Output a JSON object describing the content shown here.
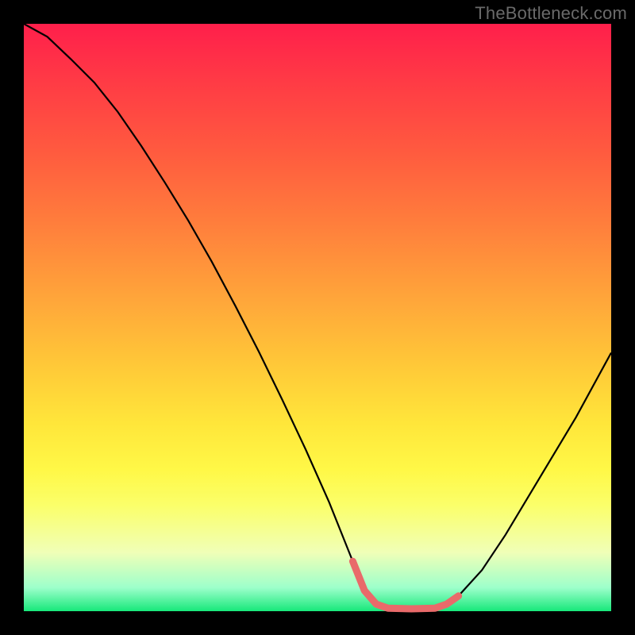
{
  "watermark": "TheBottleneck.com",
  "chart_data": {
    "type": "line",
    "title": "",
    "xlabel": "",
    "ylabel": "",
    "xlim": [
      0,
      100
    ],
    "ylim": [
      0,
      100
    ],
    "grid": false,
    "series": [
      {
        "name": "curve",
        "color": "#000000",
        "x": [
          0,
          4,
          8,
          12,
          16,
          20,
          24,
          28,
          32,
          36,
          40,
          44,
          48,
          52,
          56,
          58,
          60,
          62,
          66,
          70,
          72,
          74,
          78,
          82,
          88,
          94,
          100
        ],
        "values": [
          100,
          97.8,
          94,
          90,
          85,
          79.2,
          73,
          66.5,
          59.5,
          52,
          44.2,
          36,
          27.5,
          18.5,
          8.5,
          3.5,
          1.2,
          0.5,
          0.4,
          0.5,
          1.2,
          2.6,
          7,
          13,
          23,
          33,
          44
        ]
      },
      {
        "name": "accent",
        "color": "#e96a6a",
        "x": [
          56,
          58,
          60,
          62,
          66,
          70,
          72,
          74
        ],
        "values": [
          8.5,
          3.5,
          1.2,
          0.5,
          0.4,
          0.5,
          1.2,
          2.6
        ]
      }
    ],
    "background_gradient_stops": [
      {
        "pos": 0,
        "color": "#ff1f4b"
      },
      {
        "pos": 10,
        "color": "#ff3b45"
      },
      {
        "pos": 22,
        "color": "#ff5b3f"
      },
      {
        "pos": 34,
        "color": "#ff7e3c"
      },
      {
        "pos": 46,
        "color": "#ffa33a"
      },
      {
        "pos": 58,
        "color": "#ffc838"
      },
      {
        "pos": 68,
        "color": "#ffe63a"
      },
      {
        "pos": 76,
        "color": "#fff847"
      },
      {
        "pos": 82,
        "color": "#fbff6a"
      },
      {
        "pos": 90,
        "color": "#f0ffb7"
      },
      {
        "pos": 96,
        "color": "#9dffcb"
      },
      {
        "pos": 100,
        "color": "#17e87a"
      }
    ]
  }
}
